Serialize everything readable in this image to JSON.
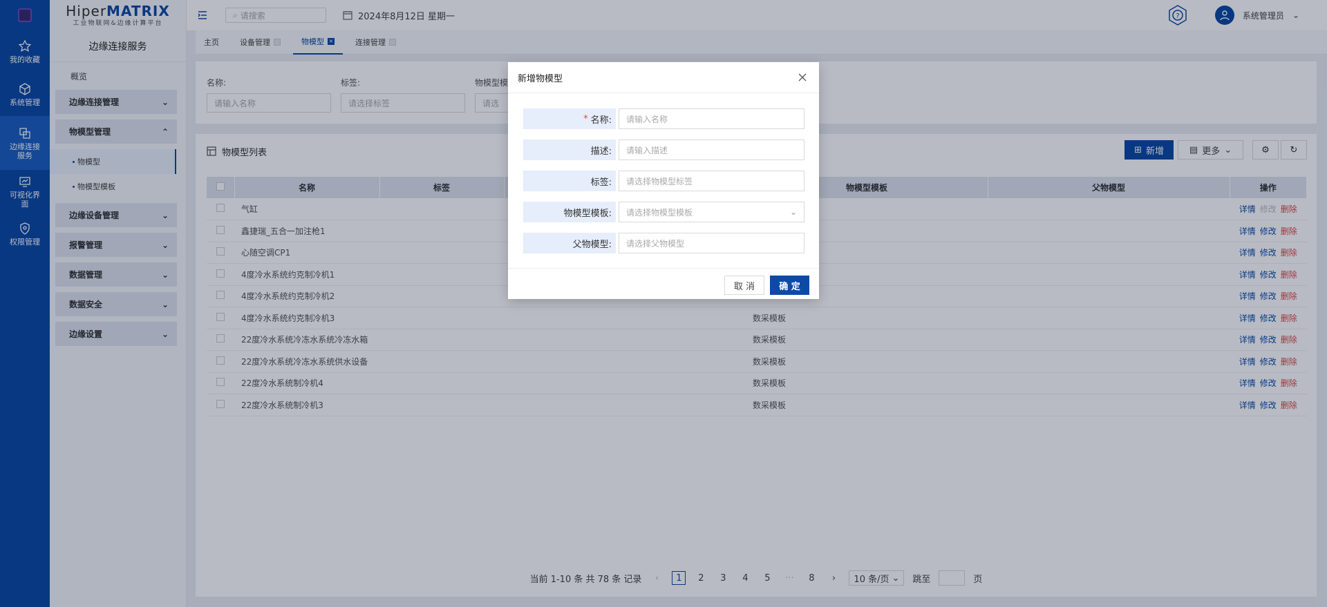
{
  "brand": {
    "title_a": "Hiper",
    "title_b": "MATRIX",
    "subtitle": "工业物联网&边缘计算平台"
  },
  "rail": [
    {
      "label": "我的收藏"
    },
    {
      "label": "系统管理"
    },
    {
      "label": "边缘连接服务"
    },
    {
      "label": "可视化界面"
    },
    {
      "label": "权限管理"
    }
  ],
  "sidebar": {
    "heading": "边缘连接服务",
    "overview": "概览",
    "groups": [
      "边缘连接管理",
      "物模型管理",
      "边缘设备管理",
      "报警管理",
      "数据管理",
      "数据安全",
      "边缘设置"
    ],
    "subitems": [
      "物模型",
      "物模型模板"
    ]
  },
  "topbar": {
    "search_placeholder": "请搜索",
    "date": "2024年8月12日 星期一",
    "user": "系统管理员"
  },
  "tabs": [
    "主页",
    "设备管理",
    "物模型",
    "连接管理"
  ],
  "filters": [
    {
      "label": "名称:",
      "placeholder": "请输入名称"
    },
    {
      "label": "标签:",
      "placeholder": "请选择标签"
    },
    {
      "label": "物模型模",
      "placeholder": "请选"
    }
  ],
  "list": {
    "title": "物模型列表",
    "new_label": "新增",
    "more_label": "更多",
    "columns": [
      "名称",
      "标签",
      "物模型模板",
      "父物模型",
      "操作"
    ],
    "rows": [
      {
        "name": "气缸",
        "template": ""
      },
      {
        "name": "鑫捷瑞_五合一加注枪1",
        "template": ""
      },
      {
        "name": "心随空调CP1",
        "template": ""
      },
      {
        "name": "4度冷水系统约克制冷机1",
        "template": ""
      },
      {
        "name": "4度冷水系统约克制冷机2",
        "template": ""
      },
      {
        "name": "4度冷水系统约克制冷机3",
        "template": "数采模板"
      },
      {
        "name": "22度冷水系统冷冻水系统冷冻水箱",
        "template": "数采模板"
      },
      {
        "name": "22度冷水系统冷冻水系统供水设备",
        "template": "数采模板"
      },
      {
        "name": "22度冷水系统制冷机4",
        "template": "数采模板"
      },
      {
        "name": "22度冷水系统制冷机3",
        "template": "数采模板"
      }
    ],
    "ops": {
      "detail": "详情",
      "edit": "修改",
      "delete": "删除"
    }
  },
  "pager": {
    "summary": "当前 1-10 条 共 78 条 记录",
    "pages": [
      "1",
      "2",
      "3",
      "4",
      "5",
      "···",
      "8"
    ],
    "size": "10 条/页",
    "jump": "跳至",
    "page": "页"
  },
  "modal": {
    "title": "新增物模型",
    "fields": [
      {
        "label": "名称:",
        "placeholder": "请输入名称",
        "required": true
      },
      {
        "label": "描述:",
        "placeholder": "请输入描述"
      },
      {
        "label": "标签:",
        "placeholder": "请选择物模型标签"
      },
      {
        "label": "物模型模板:",
        "placeholder": "请选择物模型模板",
        "select": true
      },
      {
        "label": "父物模型:",
        "placeholder": "请选择父物模型"
      }
    ],
    "cancel": "取 消",
    "ok": "确 定"
  },
  "colors": {
    "primary": "#0d4aa6",
    "danger": "#e04848"
  }
}
